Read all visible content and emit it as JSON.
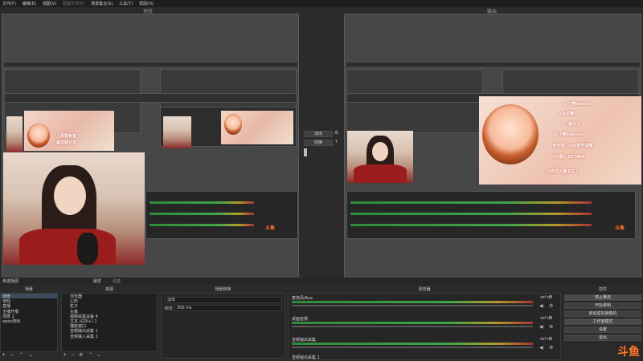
{
  "menu": {
    "items": [
      "文件(F)",
      "编辑(E)",
      "视图(V)",
      "配置文件(P)",
      "场景集合(S)",
      "工具(T)",
      "帮助(H)"
    ]
  },
  "preview_label": "预览",
  "program_label": "输出",
  "transition_buttons": {
    "fade": "淡出",
    "switch": "切换",
    "quick_transition": "场景转换",
    "add_quick": "+"
  },
  "overlay": {
    "left_lines": [
      "上周粥食堂",
      "喜欢就分享",
      "关注我哦"
    ],
    "right_lines": [
      "@ 小樱sakura",
      "@会变魔法",
      "一键关注",
      "@ 小樱sakura",
      "粉丝群：xxx群号请看",
      "QQ群：567894",
      "12点前关播不在了"
    ]
  },
  "status_bar": {
    "no_source": "未选择源",
    "properties_btn": "属性",
    "filters_btn": "滤镜"
  },
  "docks": {
    "scenes": {
      "title": "场景",
      "items": [
        "场景",
        "游戏",
        "直播",
        "主播开播",
        "场景 2",
        "apex游戏"
      ],
      "selected": 0
    },
    "sources": {
      "title": "来源",
      "items": [
        "浏览器",
        "心形",
        "粒子",
        "头像",
        "视频采集设备 4",
        "文本 (GDI+) 1",
        "捕获窗口",
        "音频输出采集 1",
        "音频输入采集 1"
      ]
    },
    "transitions": {
      "title": "场景转换",
      "selected": "淡出",
      "duration_label": "时长",
      "duration_value": "300 ms"
    },
    "mixer": {
      "title": "混音器",
      "channels": [
        {
          "name": "麦克风/Aux",
          "db": "-inf dB"
        },
        {
          "name": "桌面音频",
          "db": "-inf dB"
        },
        {
          "name": "音频输出采集",
          "db": "-inf dB"
        }
      ],
      "extra_label": "音频输出采集 1"
    },
    "controls": {
      "title": "控件",
      "buttons": [
        "停止推流",
        "开始录制",
        "启动虚拟摄像机",
        "工作室模式",
        "设置",
        "退出"
      ]
    }
  },
  "watermark": {
    "text": "斗鱼",
    "small_text": "斗鱼"
  },
  "colors": {
    "accent_red": "#9b1c1c",
    "brand_orange": "#ff7d38",
    "meter_green": "#3fa44a"
  }
}
